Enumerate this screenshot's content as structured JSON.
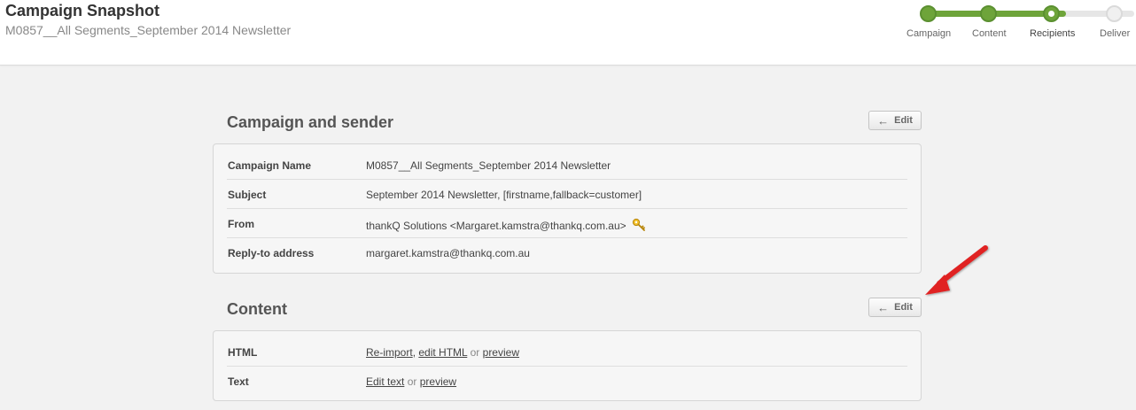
{
  "header": {
    "title": "Campaign Snapshot",
    "subtitle": "M0857__All Segments_September 2014 Newsletter"
  },
  "progress": {
    "completed_fraction": 0.67,
    "steps": [
      {
        "label": "Campaign",
        "state": "done"
      },
      {
        "label": "Content",
        "state": "done"
      },
      {
        "label": "Recipients",
        "state": "current"
      },
      {
        "label": "Deliver",
        "state": "pending"
      }
    ]
  },
  "campaign_section": {
    "title": "Campaign and sender",
    "edit_label": "Edit",
    "rows": [
      {
        "label": "Campaign Name",
        "value": "M0857__All Segments_September 2014 Newsletter"
      },
      {
        "label": "Subject",
        "value": "September 2014 Newsletter, [firstname,fallback=customer]"
      },
      {
        "label": "From",
        "value": "thankQ Solutions <Margaret.kamstra@thankq.com.au>",
        "icon": "key-icon"
      },
      {
        "label": "Reply-to address",
        "value": "margaret.kamstra@thankq.com.au"
      }
    ]
  },
  "content_section": {
    "title": "Content",
    "edit_label": "Edit",
    "html_row": {
      "label": "HTML",
      "reimport": "Re-import",
      "comma": ",",
      "edit_html": "edit HTML",
      "or": "or",
      "preview": "preview"
    },
    "text_row": {
      "label": "Text",
      "edit_text": "Edit text",
      "or": "or",
      "preview": "preview"
    }
  },
  "colors": {
    "accent_green": "#6ea43a",
    "annotation_red": "#e02020"
  }
}
